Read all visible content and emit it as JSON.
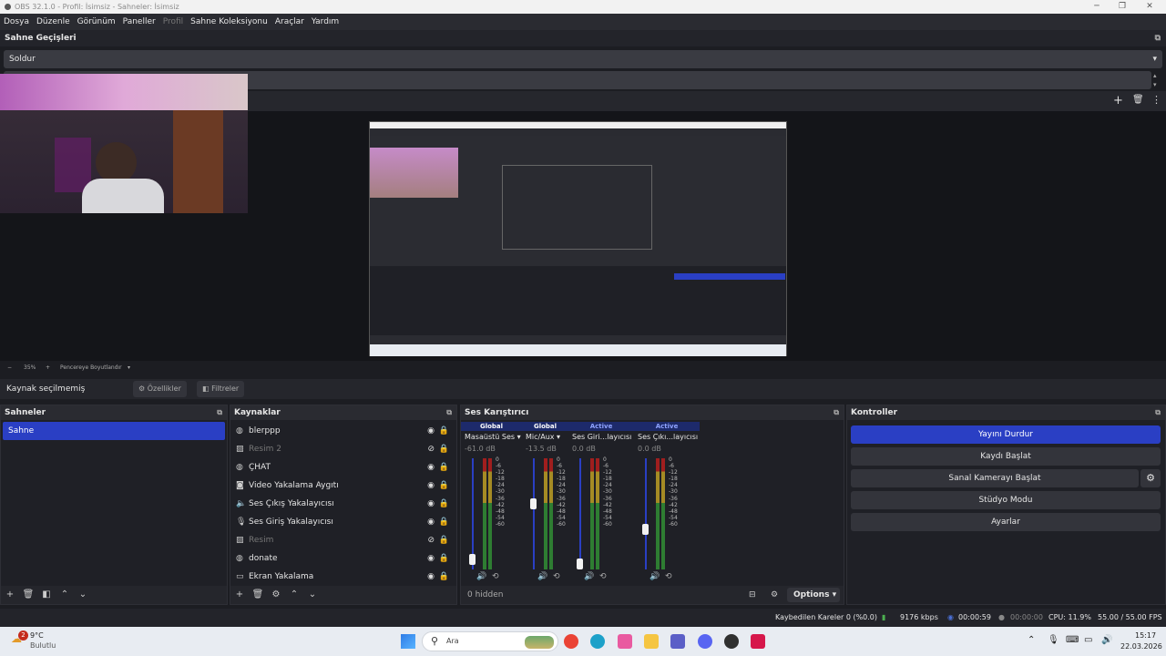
{
  "window": {
    "title": "OBS 32.1.0 - Profil: İsimsiz - Sahneler: İsimsiz"
  },
  "menu": [
    "Dosya",
    "Düzenle",
    "Görünüm",
    "Paneller",
    "Profil",
    "Sahne Koleksiyonu",
    "Araçlar",
    "Yardım"
  ],
  "transitions": {
    "header": "Sahne Geçişleri",
    "selected": "Soldur"
  },
  "zoom": {
    "percent": "35%",
    "mode": "Pencereye Boyutlandır"
  },
  "context": {
    "no_source": "Kaynak seçilmemiş",
    "properties": "Özellikler",
    "filters": "Filtreler"
  },
  "scenes": {
    "header": "Sahneler",
    "items": [
      "Sahne"
    ]
  },
  "sources": {
    "header": "Kaynaklar",
    "items": [
      {
        "label": "blerppp",
        "icon": "globe-icon",
        "visible": true
      },
      {
        "label": "Resim 2",
        "icon": "image-icon",
        "visible": false
      },
      {
        "label": "ÇHAT",
        "icon": "globe-icon",
        "visible": true
      },
      {
        "label": "Video Yakalama Aygıtı",
        "icon": "camera-icon",
        "visible": true
      },
      {
        "label": "Ses Çıkış Yakalayıcısı",
        "icon": "speaker-icon",
        "visible": true
      },
      {
        "label": "Ses Giriş Yakalayıcısı",
        "icon": "microphone-icon",
        "visible": true
      },
      {
        "label": "Resim",
        "icon": "image-icon",
        "visible": false
      },
      {
        "label": "donate",
        "icon": "globe-icon",
        "visible": true
      },
      {
        "label": "Ekran Yakalama",
        "icon": "monitor-icon",
        "visible": true
      }
    ]
  },
  "mixer": {
    "header": "Ses Karıştırıcı",
    "hidden": "0 hidden",
    "options": "Options",
    "scale": [
      "0",
      "-6",
      "-12",
      "-18",
      "-24",
      "-30",
      "-36",
      "-42",
      "-48",
      "-54",
      "-60"
    ],
    "channels": [
      {
        "tag": "Global",
        "name": "Masaüstü Ses",
        "db": "-61.0 dB",
        "level": 0.05
      },
      {
        "tag": "Global",
        "name": "Mic/Aux",
        "db": "-13.5 dB",
        "level": 0.6
      },
      {
        "tag": "Active",
        "name": "Ses Giri...layıcısı",
        "db": "0.0 dB",
        "level": 0.0
      },
      {
        "tag": "Active",
        "name": "Ses Çıkı...layıcısı",
        "db": "0.0 dB",
        "level": 0.35
      }
    ]
  },
  "controls": {
    "header": "Kontroller",
    "stop_stream": "Yayını Durdur",
    "start_record": "Kaydı Başlat",
    "virtual_cam": "Sanal Kamerayı Başlat",
    "studio_mode": "Stüdyo Modu",
    "settings": "Ayarlar"
  },
  "status": {
    "dropped": "Kaybedilen Kareler 0 (%0.0)",
    "bitrate": "9176 kbps",
    "stream_time": "00:00:59",
    "record_time": "00:00:00",
    "cpu": "CPU: 11.9%",
    "fps": "55.00 / 55.00 FPS"
  },
  "taskbar": {
    "weather_temp": "9°C",
    "weather_desc": "Bulutlu",
    "weather_badge": "2",
    "search": "Ara",
    "time": "15:17",
    "date": "22.03.2026"
  }
}
